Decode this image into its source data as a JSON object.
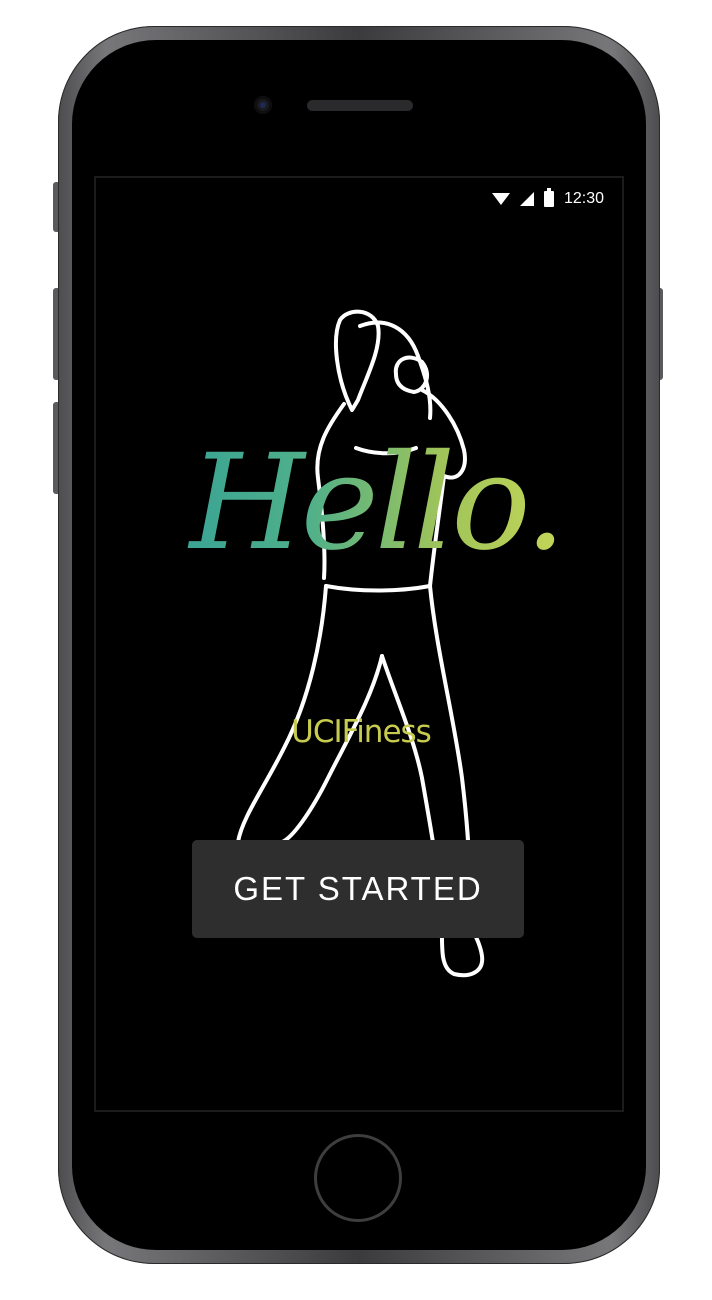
{
  "status_bar": {
    "time": "12:30",
    "icons": [
      "wifi-icon",
      "cellular-signal-icon",
      "battery-icon"
    ]
  },
  "hero": {
    "greeting": "Hello.",
    "app_name": "UCIFiness",
    "gradient_colors": [
      "#2b9a9a",
      "#4fb08a",
      "#9fc45a",
      "#d6df55"
    ]
  },
  "cta": {
    "label": "GET STARTED",
    "background": "#2e2e2e"
  },
  "theme": {
    "screen_background": "#000000",
    "brand_color": "#c8cc4e"
  }
}
